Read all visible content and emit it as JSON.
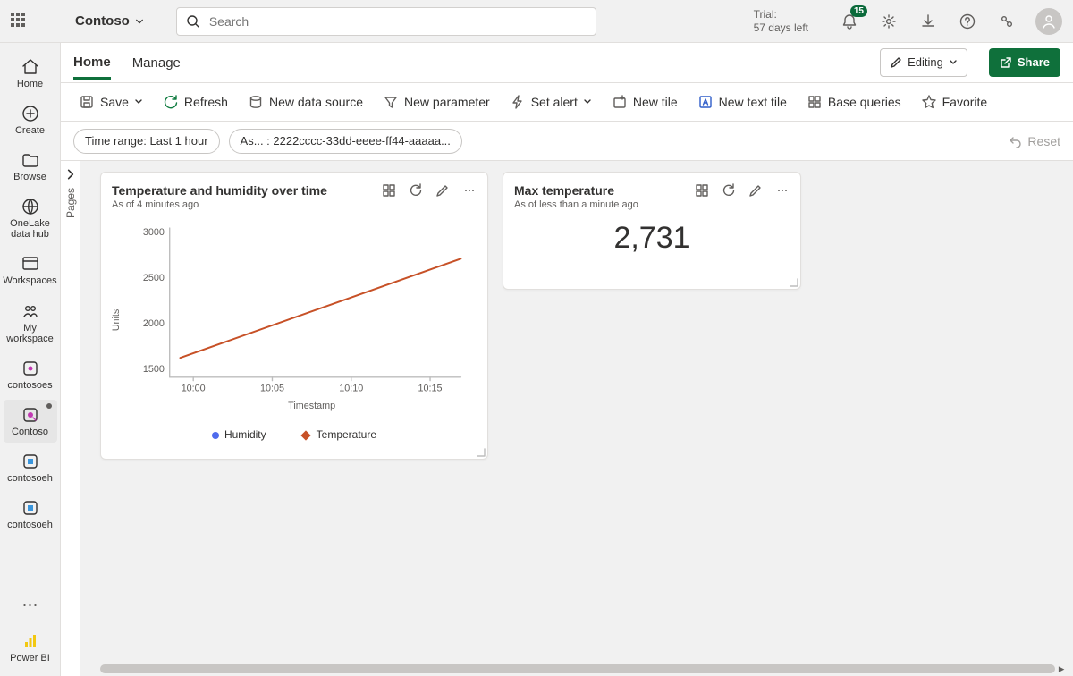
{
  "header": {
    "brand": "Contoso",
    "search_placeholder": "Search",
    "trial_label": "Trial:",
    "trial_value": "57 days left",
    "notif_count": "15"
  },
  "rail": {
    "items": [
      {
        "label": "Home"
      },
      {
        "label": "Create"
      },
      {
        "label": "Browse"
      },
      {
        "label": "OneLake data hub"
      },
      {
        "label": "Workspaces"
      },
      {
        "label": "My workspace"
      },
      {
        "label": "contosoes"
      },
      {
        "label": "Contoso"
      },
      {
        "label": "contosoeh"
      },
      {
        "label": "contosoeh"
      }
    ],
    "bottom_label": "Power BI"
  },
  "tabs": {
    "home": "Home",
    "manage": "Manage",
    "editing": "Editing",
    "share": "Share"
  },
  "cmd": {
    "save": "Save",
    "refresh": "Refresh",
    "new_ds": "New data source",
    "new_param": "New parameter",
    "set_alert": "Set alert",
    "new_tile": "New tile",
    "new_text": "New text tile",
    "base_q": "Base queries",
    "favorite": "Favorite"
  },
  "params": {
    "time_range": "Time range: Last 1 hour",
    "asset": "As... : 2222cccc-33dd-eeee-ff44-aaaaa...",
    "reset": "Reset"
  },
  "pages_label": "Pages",
  "tile1": {
    "title": "Temperature and humidity over time",
    "sub": "As of 4 minutes ago",
    "ylabel": "Units",
    "xlabel": "Timestamp",
    "legend_a": "Humidity",
    "legend_b": "Temperature"
  },
  "tile2": {
    "title": "Max temperature",
    "sub": "As of less than a minute ago",
    "value": "2,731"
  },
  "chart_data": {
    "type": "line",
    "title": "Temperature and humidity over time",
    "xlabel": "Timestamp",
    "ylabel": "Units",
    "categories": [
      "10:00",
      "10:05",
      "10:10",
      "10:15"
    ],
    "ylim": [
      1500,
      3000
    ],
    "series": [
      {
        "name": "Humidity",
        "color": "#4f6bed",
        "values": [
          1650,
          2010,
          2370,
          2730
        ]
      },
      {
        "name": "Temperature",
        "color": "#c75127",
        "values": [
          1650,
          2010,
          2370,
          2730
        ]
      }
    ]
  }
}
